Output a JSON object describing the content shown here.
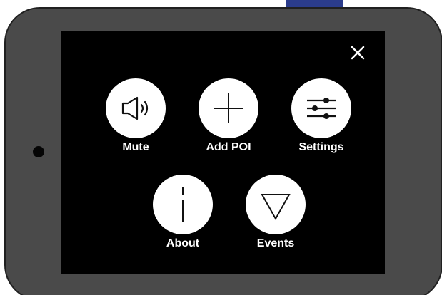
{
  "menu": {
    "close_icon": "close-icon",
    "items": [
      {
        "label": "Mute",
        "icon": "speaker-icon"
      },
      {
        "label": "Add POI",
        "icon": "plus-icon"
      },
      {
        "label": "Settings",
        "icon": "sliders-icon"
      },
      {
        "label": "About",
        "icon": "info-icon"
      },
      {
        "label": "Events",
        "icon": "triangle-down-icon"
      }
    ]
  },
  "colors": {
    "device_body": "#4a4a4a",
    "device_border": "#202020",
    "screen": "#000000",
    "button_fill": "#ffffff",
    "label_text": "#ffffff",
    "tab_peek": "#2b3c8c"
  }
}
